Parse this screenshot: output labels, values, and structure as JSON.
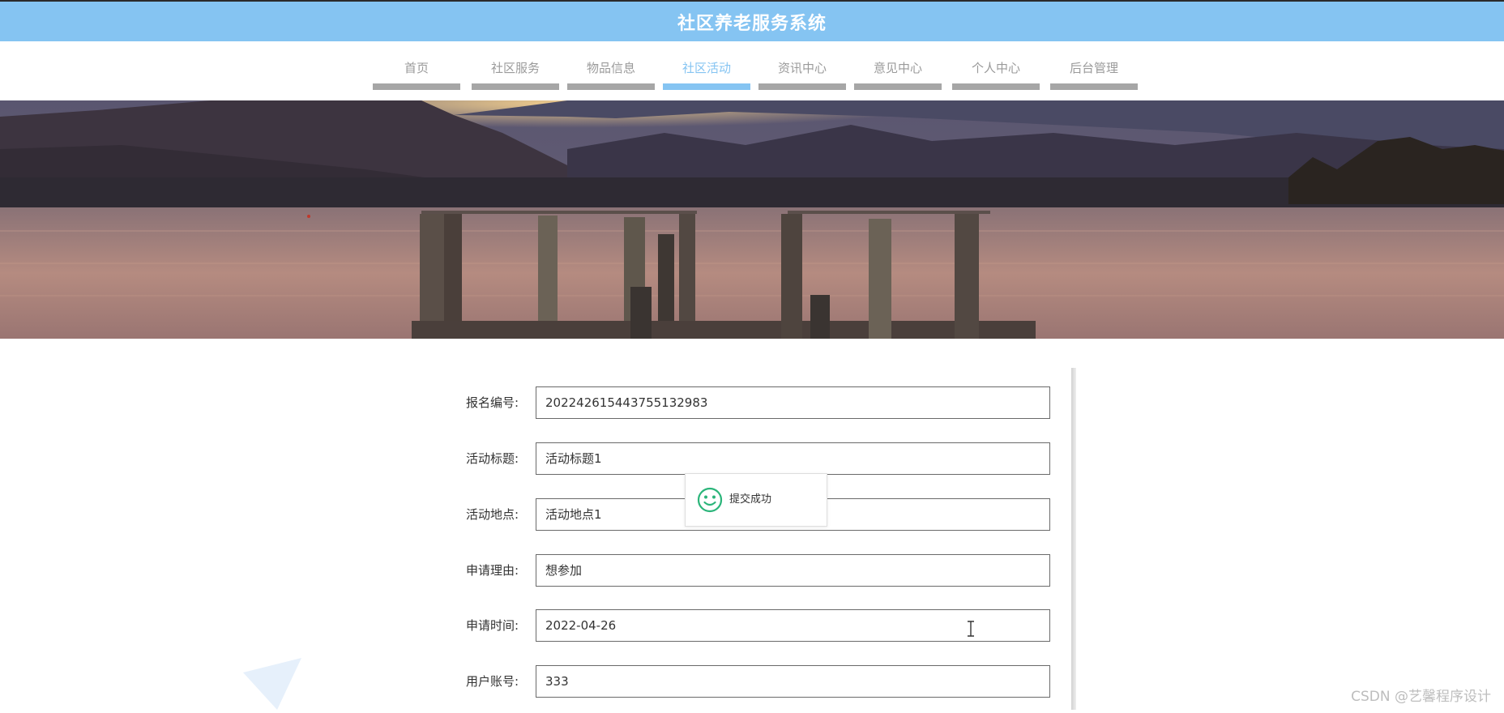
{
  "header": {
    "title": "社区养老服务系统"
  },
  "nav": {
    "items": [
      {
        "label": "首页"
      },
      {
        "label": "社区服务"
      },
      {
        "label": "物品信息"
      },
      {
        "label": "社区活动",
        "active": true
      },
      {
        "label": "资讯中心"
      },
      {
        "label": "意见中心"
      },
      {
        "label": "个人中心"
      },
      {
        "label": "后台管理"
      }
    ]
  },
  "form": {
    "fields": [
      {
        "label": "报名编号:",
        "value": "202242615443755132983"
      },
      {
        "label": "活动标题:",
        "value": "活动标题1"
      },
      {
        "label": "活动地点:",
        "value": "活动地点1"
      },
      {
        "label": "申请理由:",
        "value": "想参加"
      },
      {
        "label": "申请时间:",
        "value": "2022-04-26"
      },
      {
        "label": "用户账号:",
        "value": "333"
      }
    ]
  },
  "toast": {
    "message": "提交成功",
    "icon": "smile-icon"
  },
  "watermark": {
    "text": "CSDN @艺馨程序设计"
  },
  "colors": {
    "accent": "#85c4f2",
    "nav_inactive": "#a6a6a6",
    "toast_icon": "#2bb57a"
  }
}
